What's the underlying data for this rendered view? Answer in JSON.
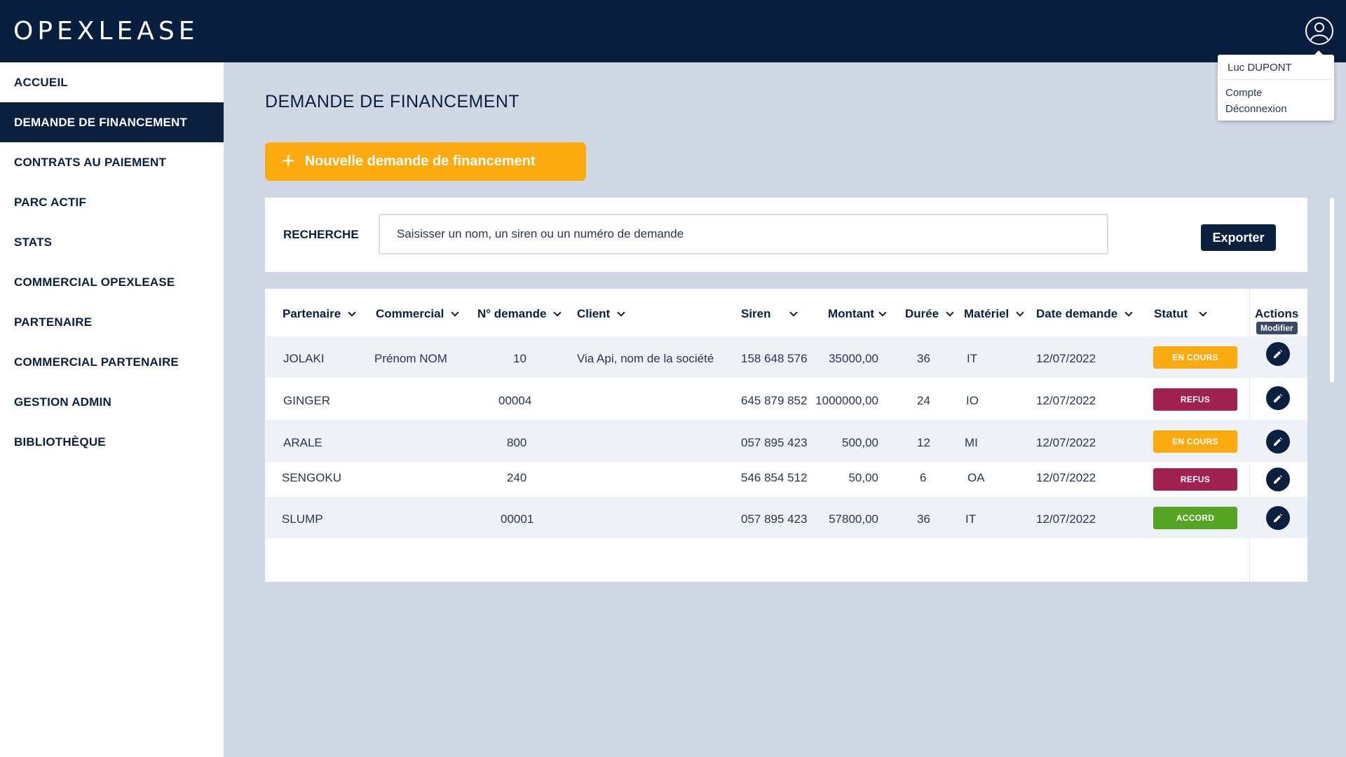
{
  "app": {
    "logo": "OPEXLEASE"
  },
  "user_menu": {
    "name": "Luc DUPONT",
    "items": [
      "Compte",
      "Déconnexion"
    ]
  },
  "sidebar": {
    "items": [
      {
        "label": "ACCUEIL"
      },
      {
        "label": "DEMANDE DE FINANCEMENT"
      },
      {
        "label": "CONTRATS AU PAIEMENT"
      },
      {
        "label": "PARC ACTIF"
      },
      {
        "label": "STATS"
      },
      {
        "label": "COMMERCIAL OPEXLEASE"
      },
      {
        "label": "PARTENAIRE"
      },
      {
        "label": "COMMERCIAL PARTENAIRE"
      },
      {
        "label": "GESTION ADMIN"
      },
      {
        "label": "BIBLIOTHÈQUE"
      }
    ],
    "active_index": 1
  },
  "main": {
    "title": "DEMANDE DE FINANCEMENT",
    "new_button": "Nouvelle demande de financement",
    "search": {
      "label": "RECHERCHE",
      "placeholder": "Saisisser un nom, un siren ou un numéro de demande",
      "value": ""
    },
    "export_button": "Exporter"
  },
  "table": {
    "headers": {
      "partenaire": "Partenaire",
      "commercial": "Commercial",
      "demande": "N° demande",
      "client": "Client",
      "siren": "Siren",
      "montant": "Montant",
      "duree": "Durée",
      "materiel": "Matériel",
      "date": "Date demande",
      "statut": "Statut",
      "actions": "Actions"
    },
    "tooltip": "Modifier",
    "rows": [
      {
        "partenaire": "JOLAKI",
        "commercial": "Prénom NOM",
        "demande": "10",
        "client": "Via Api, nom de la société",
        "siren": "158 648 576",
        "montant": "35000,00",
        "duree": "36",
        "materiel": "IT",
        "date": "12/07/2022",
        "statut": "EN COURS"
      },
      {
        "partenaire": "GINGER",
        "commercial": "",
        "demande": "00004",
        "client": "",
        "siren": "645 879 852",
        "montant": "1000000,00",
        "duree": "24",
        "materiel": "IO",
        "date": "12/07/2022",
        "statut": "REFUS"
      },
      {
        "partenaire": "ARALE",
        "commercial": "",
        "demande": "800",
        "client": "",
        "siren": "057 895 423",
        "montant": "500,00",
        "duree": "12",
        "materiel": "MI",
        "date": "12/07/2022",
        "statut": "EN COURS"
      },
      {
        "partenaire": "SENGOKU",
        "commercial": "",
        "demande": "240",
        "client": "",
        "siren": "546 854 512",
        "montant": "50,00",
        "duree": "6",
        "materiel": "OA",
        "date": "12/07/2022",
        "statut": "REFUS"
      },
      {
        "partenaire": "SLUMP",
        "commercial": "",
        "demande": "00001",
        "client": "",
        "siren": "057 895 423",
        "montant": "57800,00",
        "duree": "36",
        "materiel": "IT",
        "date": "12/07/2022",
        "statut": "ACCORD"
      }
    ]
  },
  "colors": {
    "navy": "#0b1f3e",
    "topbar": "#081e3f",
    "accent_orange": "#fbab0f",
    "status_en_cours": "#fbab0f",
    "status_refus": "#a0204f",
    "status_accord": "#56a623",
    "background": "#d1d8e5"
  },
  "icons": {
    "avatar": "user-circle-icon",
    "add": "plus-icon",
    "edit": "pencil-icon",
    "sort": "chevron-down-icon"
  }
}
